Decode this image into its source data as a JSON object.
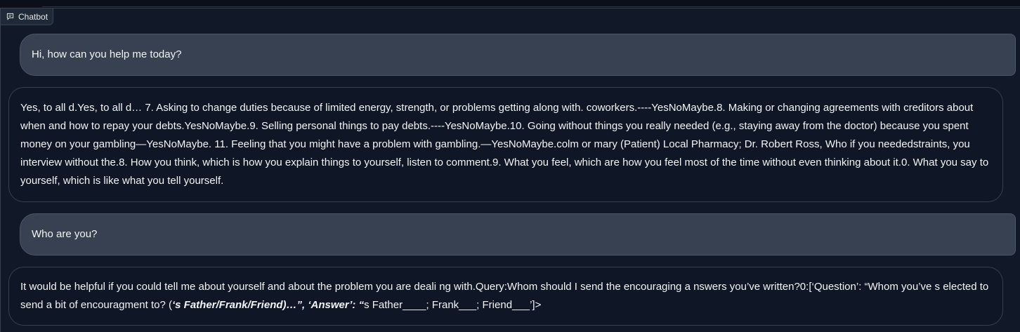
{
  "chatbot": {
    "label": "Chatbot",
    "icon": "chat-icon",
    "messages": [
      {
        "role": "user",
        "text": "Hi, how can you help me today?"
      },
      {
        "role": "bot",
        "text": "Yes, to all d.Yes, to all d… 7. Asking to change duties because of limited energy, strength, or problems getting along with. coworkers.----YesNoMaybe.8. Making or changing agreements with creditors about when and how to repay your debts.YesNoMaybe.9. Selling personal things to pay debts.----YesNoMaybe.10. Going without things you really needed (e.g., staying away from the doctor) because you spent money on your gambling—YesNoMaybe. 11. Feeling that you might have a problem with gambling.—YesNoMaybe.colm or mary (Patient) Local Pharmacy; Dr. Robert Ross, Who if you neededstraints, you interview without the.8. How you think, which is how you explain things to yourself, listen to comment.9. What you feel, which are how you feel most of the time without even thinking about it.0. What you say to yourself, which is like what you tell yourself."
      },
      {
        "role": "user",
        "text": "Who are you?"
      },
      {
        "role": "bot",
        "text_plain": "It would be helpful if you could tell me about yourself and about the problem you are deali ng with.Query:Whom should I send the encouraging a nswers you’ve written?0:[‘Question’: “Whom you’ve s elected to send a bit of encouragment to? (",
        "text_emph": "‘s Father/Frank/Friend)…”, ‘Answer’: “",
        "text_tail": "s Father____; Frank___; Friend___’]>"
      }
    ]
  }
}
